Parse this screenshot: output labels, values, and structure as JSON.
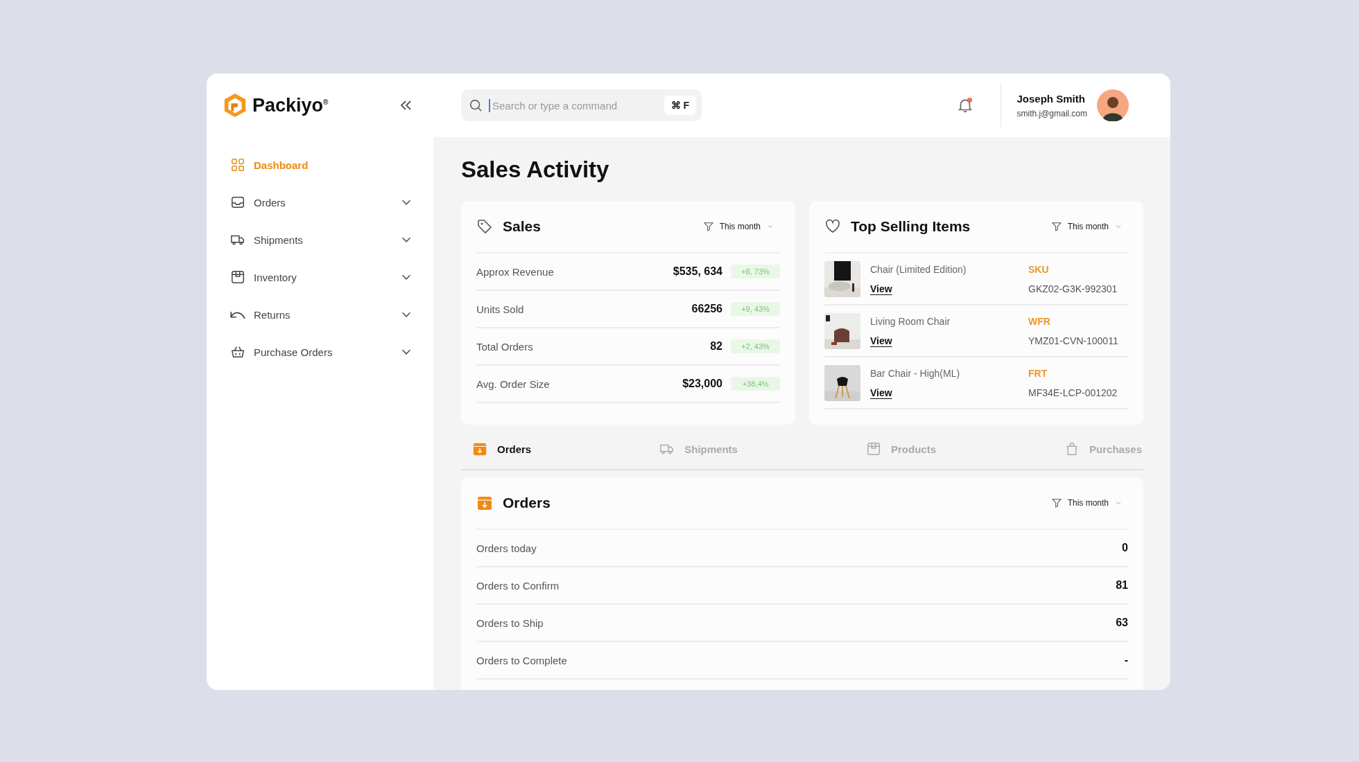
{
  "brand": {
    "name": "Packiyo$^{®}$"
  },
  "sidebar": {
    "items": [
      {
        "label": "Dashboard",
        "selected": true
      },
      {
        "label": "Orders",
        "selected": false,
        "expanded": false
      },
      {
        "label": "Shipments",
        "selected": false,
        "expanded": false
      },
      {
        "label": "Inventory",
        "selected": false,
        "expanded": false
      },
      {
        "label": "Returns",
        "selected": false,
        "expanded": false
      },
      {
        "label": "Purchase Orders",
        "selected": false,
        "expanded": false
      }
    ]
  },
  "search": {
    "placeholder": "Search or type a command",
    "shortcut": "⌘ F"
  },
  "notifications": {
    "unread": true
  },
  "user": {
    "name": "Joseph Smith",
    "email": "smith.j@gmail.com"
  },
  "page_title": "Sales Activity",
  "sales": {
    "title": "Sales",
    "filter": "This month",
    "rows": [
      {
        "label": "Approx Revenue",
        "value": "$535, 634",
        "change": "+8, 73%"
      },
      {
        "label": "Units Sold",
        "value": "66256",
        "change": "+9, 43%"
      },
      {
        "label": "Total Orders",
        "value": "82",
        "change": "+2, 43%"
      },
      {
        "label": "Avg. Order Size",
        "value": "$23,000",
        "change": "+38,4%"
      }
    ]
  },
  "top_selling": {
    "title": "Top Selling Items",
    "filter": "This month",
    "items": [
      {
        "name": "Chair (Limited Edition)",
        "link": "View",
        "code_label": "SKU",
        "code": "GKZ02-G3K-992301"
      },
      {
        "name": "Living Room Chair",
        "link": "View",
        "code_label": "WFR",
        "code": "YMZ01-CVN-100011"
      },
      {
        "name": "Bar Chair - High(ML)",
        "link": "View",
        "code_label": "FRT",
        "code": "MF34E-LCP-001202"
      }
    ]
  },
  "tabs": [
    {
      "label": "Orders",
      "selected": true
    },
    {
      "label": "Shipments",
      "selected": false
    },
    {
      "label": "Products",
      "selected": false
    },
    {
      "label": "Purchases",
      "selected": false
    }
  ],
  "orders": {
    "title": "Orders",
    "filter": "This month",
    "rows": [
      {
        "label": "Orders today",
        "value": "0"
      },
      {
        "label": "Orders to Confirm",
        "value": "81"
      },
      {
        "label": "Orders to Ship",
        "value": "63"
      },
      {
        "label": "Orders to Complete",
        "value": "-"
      }
    ]
  }
}
